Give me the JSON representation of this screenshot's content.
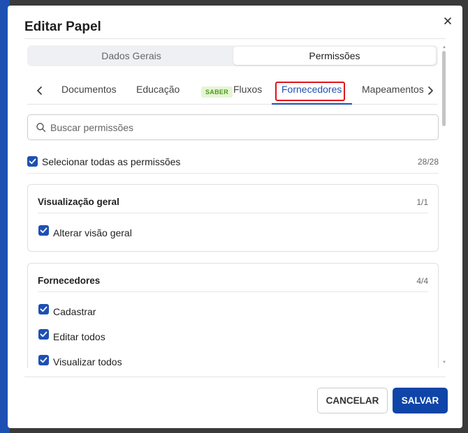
{
  "dialog": {
    "title": "Editar Papel"
  },
  "segments": {
    "general": "Dados Gerais",
    "permissions": "Permissões",
    "selected": "Permissões"
  },
  "tabs": {
    "items": [
      {
        "label": "Documentos"
      },
      {
        "label": "Educação",
        "badge": "SABER"
      },
      {
        "label": "Fluxos"
      },
      {
        "label": "Fornecedores",
        "active": true
      },
      {
        "label": "Mapeamentos"
      }
    ]
  },
  "search": {
    "placeholder": "Buscar permissões",
    "value": ""
  },
  "select_all": {
    "label": "Selecionar todas as permissões",
    "count": "28/28",
    "checked": true
  },
  "groups": [
    {
      "title": "Visualização geral",
      "count": "1/1",
      "items": [
        {
          "label": "Alterar visão geral",
          "checked": true
        }
      ]
    },
    {
      "title": "Fornecedores",
      "count": "4/4",
      "items": [
        {
          "label": "Cadastrar",
          "checked": true
        },
        {
          "label": "Editar todos",
          "checked": true
        },
        {
          "label": "Visualizar todos",
          "checked": true
        }
      ]
    }
  ],
  "footer": {
    "cancel_label": "CANCELAR",
    "save_label": "SALVAR"
  },
  "colors": {
    "primary": "#0f45a8",
    "accent": "#1e50b4",
    "highlight_border": "#e0141b",
    "badge_bg": "#e5f5d5",
    "badge_text": "#4c9a17"
  },
  "icons": {
    "close": "close-icon",
    "search": "search-icon",
    "chevron_left": "chevron-left-icon",
    "chevron_right": "chevron-right-icon",
    "check": "check-icon"
  }
}
